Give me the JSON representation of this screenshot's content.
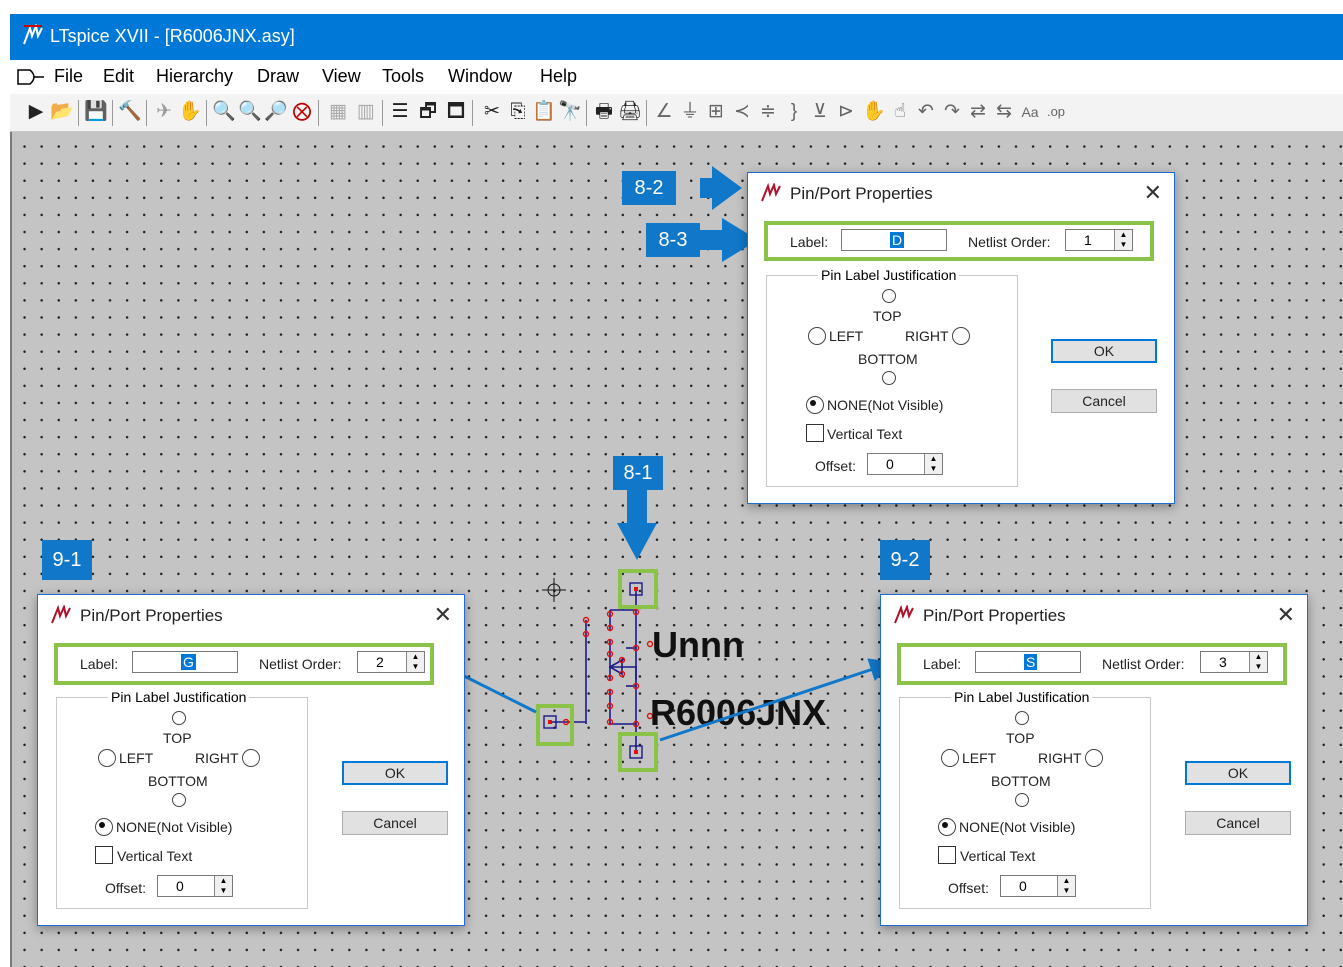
{
  "window": {
    "title": "LTspice XVII - [R6006JNX.asy]"
  },
  "menu": {
    "items": [
      "File",
      "Edit",
      "Hierarchy",
      "Draw",
      "View",
      "Tools",
      "Window",
      "Help"
    ]
  },
  "colors": {
    "titlebar": "#0078d7",
    "canvas": "#c4c4c4",
    "callout": "#1177c8",
    "highlight": "#8bc34a",
    "wire": "#1a1a8a",
    "pin": "#e01010"
  },
  "symbol": {
    "text1": "Unnn",
    "text2": "R6006JNX"
  },
  "callouts": {
    "c81": "8-1",
    "c82": "8-2",
    "c83": "8-3",
    "c91": "9-1",
    "c92": "9-2"
  },
  "dialogs": [
    {
      "title": "Pin/Port Properties",
      "label_caption": "Label:",
      "label_value": "D",
      "order_caption": "Netlist Order:",
      "order_value": "1",
      "group_title": "Pin Label Justification",
      "top": "TOP",
      "left": "LEFT",
      "right": "RIGHT",
      "bottom": "BOTTOM",
      "none": "NONE(Not Visible)",
      "vertical": "Vertical Text",
      "offset_caption": "Offset:",
      "offset_value": "0",
      "ok": "OK",
      "cancel": "Cancel"
    },
    {
      "title": "Pin/Port Properties",
      "label_caption": "Label:",
      "label_value": "G",
      "order_caption": "Netlist Order:",
      "order_value": "2",
      "group_title": "Pin Label Justification",
      "top": "TOP",
      "left": "LEFT",
      "right": "RIGHT",
      "bottom": "BOTTOM",
      "none": "NONE(Not Visible)",
      "vertical": "Vertical Text",
      "offset_caption": "Offset:",
      "offset_value": "0",
      "ok": "OK",
      "cancel": "Cancel"
    },
    {
      "title": "Pin/Port Properties",
      "label_caption": "Label:",
      "label_value": "S",
      "order_caption": "Netlist Order:",
      "order_value": "3",
      "group_title": "Pin Label Justification",
      "top": "TOP",
      "left": "LEFT",
      "right": "RIGHT",
      "bottom": "BOTTOM",
      "none": "NONE(Not Visible)",
      "vertical": "Vertical Text",
      "offset_caption": "Offset:",
      "offset_value": "0",
      "ok": "OK",
      "cancel": "Cancel"
    }
  ]
}
